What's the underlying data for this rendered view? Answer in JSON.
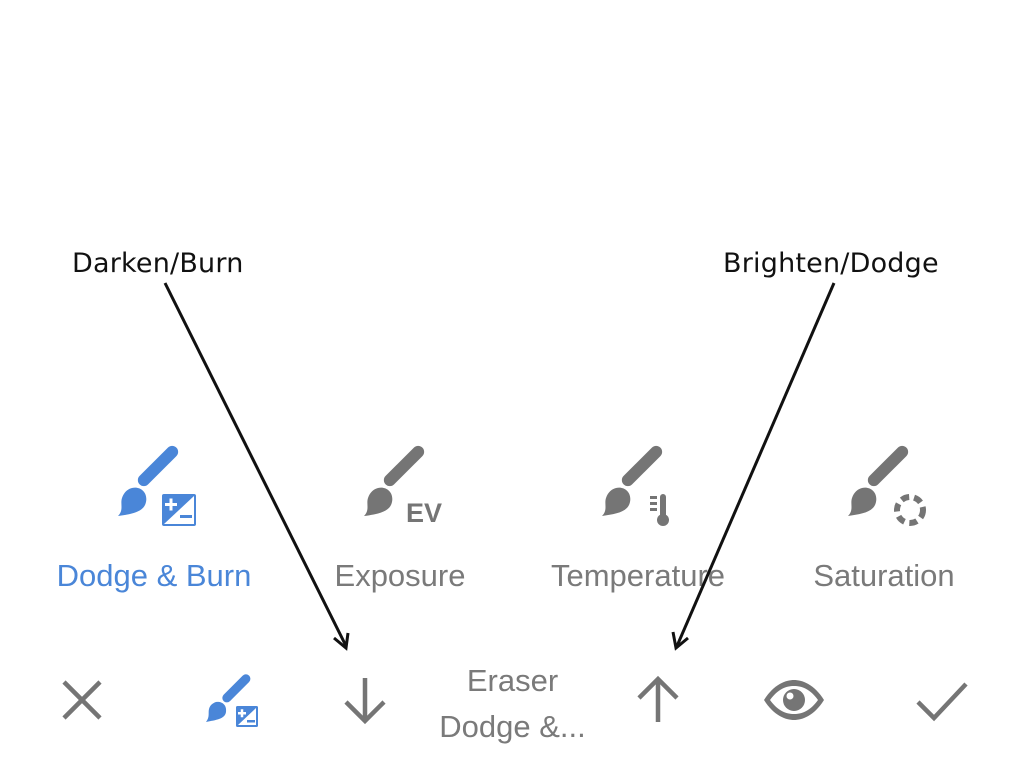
{
  "annotations": {
    "left": "Darken/Burn",
    "right": "Brighten/Dodge"
  },
  "tools": [
    {
      "label": "Dodge & Burn",
      "icon": "dodge-burn-brush-icon",
      "active": true
    },
    {
      "label": "Exposure",
      "icon": "exposure-brush-icon",
      "active": false
    },
    {
      "label": "Temperature",
      "icon": "temperature-brush-icon",
      "active": false
    },
    {
      "label": "Saturation",
      "icon": "saturation-brush-icon",
      "active": false
    }
  ],
  "toolbar": {
    "close_icon": "close-icon",
    "brush_icon": "dodge-burn-brush-icon",
    "decrease_icon": "arrow-down-icon",
    "mode_line1": "Eraser",
    "mode_line2": "Dodge &...",
    "increase_icon": "arrow-up-icon",
    "preview_icon": "eye-icon",
    "apply_icon": "check-icon"
  },
  "colors": {
    "active": "#4a86d8",
    "inactive": "#757575",
    "annotation": "#111111"
  }
}
